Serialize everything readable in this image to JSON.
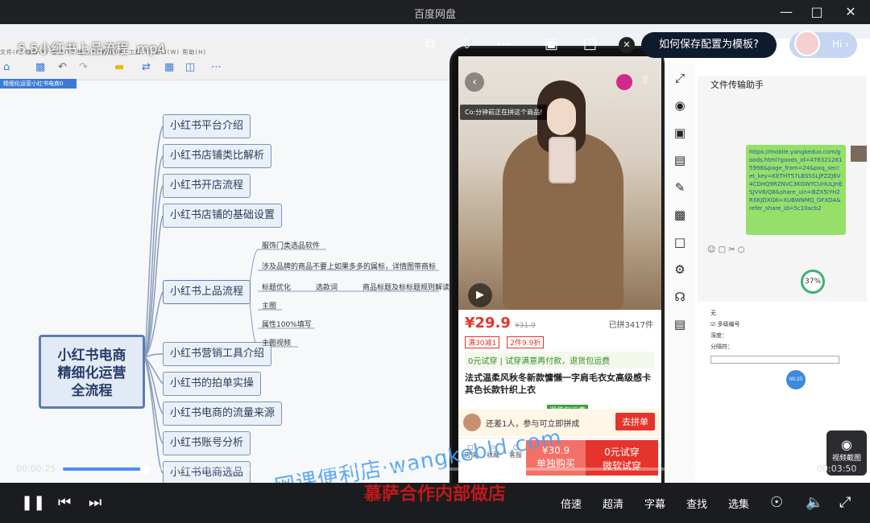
{
  "window": {
    "title": "百度网盘"
  },
  "video": {
    "filename": "5.5小红书上品流程 .mp4",
    "time_current": "00:00:25",
    "time_total": "00:03:50",
    "progress": 0.11,
    "subtitle": "慕萨合作内部做店",
    "watermark": "网课便利店·wangkebld.com"
  },
  "popup": {
    "text": "如何保存配置为模板?",
    "hi": "Hi"
  },
  "mindmap": {
    "menu": "文件(F)  编辑(E)  查看(V)  插入(I)  修改(M)  工具(T)  窗口(W)  帮助(H)",
    "tab": "精细化运营小红书电商0",
    "root": [
      "小红书电商",
      "精细化运营",
      "全流程"
    ],
    "branches": [
      "小红书平台介绍",
      "小红书店铺类比解析",
      "小红书开店流程",
      "小红书店铺的基础设置",
      "小红书上品流程",
      "小红书营销工具介绍",
      "小红书的拍单实操",
      "小红书电商的流量来源",
      "小红书账号分析",
      "小红书电商选品"
    ],
    "subitems": [
      "服饰门类选品软件",
      "涉及品牌的商品不要上如果多多的属标，详情图带商标",
      "标题优化",
      "选款词",
      "商品标题及标标题规则解读",
      "主图",
      "属性100%填写",
      "主图视频"
    ]
  },
  "product": {
    "banner": "Co:分钟前正在拼这个商品!",
    "pager": "1/10",
    "price": "¥29.9",
    "old_price": "¥31.9",
    "sold": "已拼3417件",
    "tags": [
      "满30减1",
      "2件9.9折"
    ],
    "promise": "0元试穿 | 试穿满意再付款，退货包运费",
    "name": "法式温柔风秋冬新款慵懒一字肩毛衣女高级感卡其色长款针织上衣",
    "freight_tag": "退货包运费",
    "group_text": "还差1人，参与可立即拼成",
    "group_button": "去拼单",
    "bottom_icons": [
      "店铺",
      "收藏",
      "客服"
    ],
    "buy_price": "¥30.9",
    "buy_label": "单独购买",
    "try_price": "0元试穿",
    "try_label": "微软试穿"
  },
  "right": {
    "chat_title": "文件传输助手",
    "link_text": "https://mobile.yangkeduo.com/goods.html?goods_id=4783212815998&page_from=24&pxq_secret_key=KETHT57LBSSSLJPZZJ6V4CDHQ9RZNVC3KGWYCUHULJHESJVV6/Q8&share_uin=BZX5IYH2RXKJDXG8=XUBWNMQ_GFXDA&refer_share_id=5c10acb2",
    "percent": "37%",
    "settings_labels": [
      "无",
      "多级编号",
      "深度：",
      "分隔符："
    ],
    "badge": "00:25",
    "screenshot_label": "视频截图"
  },
  "controls": {
    "labels": [
      "倍速",
      "超清",
      "字幕",
      "查找",
      "选集"
    ]
  }
}
